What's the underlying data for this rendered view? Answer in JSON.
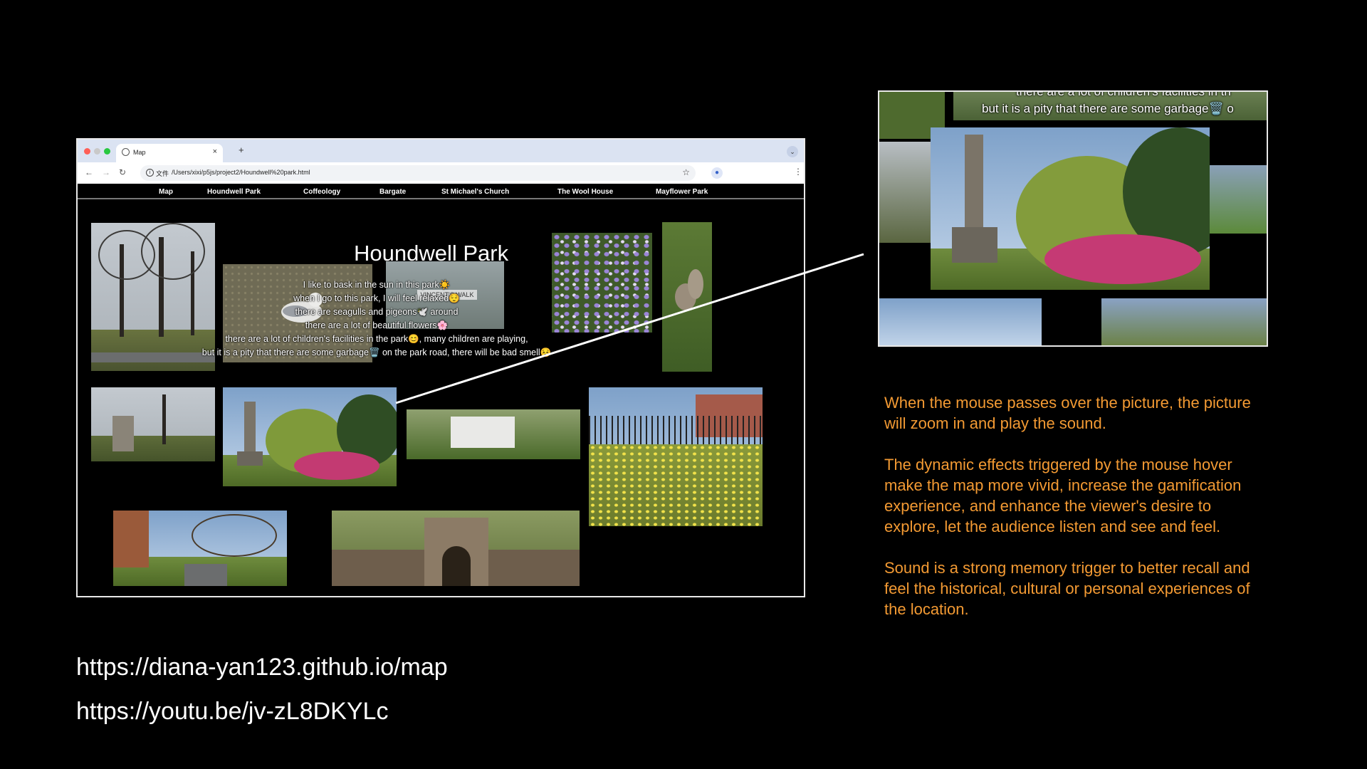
{
  "browser": {
    "tab_title": "Map",
    "new_tab_label": "+",
    "tab_close": "×",
    "tab_menu": "⌄",
    "file_label": "文件",
    "url": "/Users/xixi/p5js/project2/Houndwell%20park.html",
    "back": "←",
    "forward": "→",
    "reload": "↻",
    "star": "☆",
    "kebab": "⋮"
  },
  "site_nav": {
    "items": [
      "Map",
      "Houndwell Park",
      "Coffeology",
      "Bargate",
      "St Michael's Church",
      "The Wool House",
      "Mayflower Park"
    ]
  },
  "park": {
    "title": "Houndwell Park",
    "lines": [
      "I like to bask in the sun in this park☀️",
      "when I go to this park, I will feel relaxed😌",
      "there are seagulls and pigeons🕊️ around",
      "there are a lot of beautiful flowers🌸",
      "there are a lot of children's facilities in the park😊, many children are playing,",
      "but it is a pity that there are some garbage🗑️ on the park road, there will be bad smell😣"
    ],
    "sign_text": "VINCENT'S WALK"
  },
  "inset": {
    "line1": "there are a lot of children's facilities in th",
    "line2": "but it is a pity that there are some garbage🗑️ o"
  },
  "description": {
    "p1": "When the mouse passes over the picture, the picture will zoom in and play the sound.",
    "p2": "The dynamic effects triggered by the mouse hover make the map more vivid, increase the gamification experience, and enhance the viewer's desire to explore, let the audience listen and see and feel.",
    "p3": "Sound is a strong memory trigger to better recall and feel the historical, cultural or personal experiences of the location."
  },
  "links": {
    "map": "https://diana-yan123.github.io/map",
    "video": "https://youtu.be/jv-zL8DKYLc"
  },
  "colors": {
    "accent_text": "#f39a33",
    "background": "#000000"
  }
}
